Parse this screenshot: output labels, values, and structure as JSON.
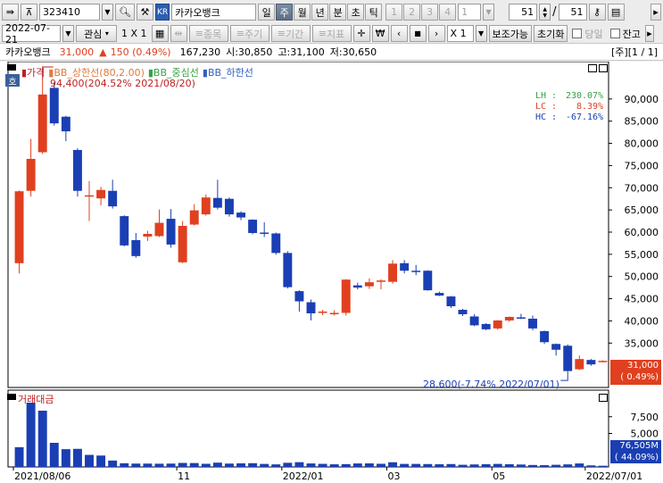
{
  "toolbar": {
    "code": "323410",
    "stock_name": "카카오뱅크",
    "periods": [
      {
        "label": "일",
        "active": false
      },
      {
        "label": "주",
        "active": true
      },
      {
        "label": "월",
        "active": false
      },
      {
        "label": "년",
        "active": false
      },
      {
        "label": "분",
        "active": false
      },
      {
        "label": "초",
        "active": false
      },
      {
        "label": "틱",
        "active": false
      }
    ],
    "ticks": [
      "1",
      "2",
      "3",
      "4"
    ],
    "tick_value": "1",
    "page_current": "51",
    "page_sep": "/",
    "page_total": "51"
  },
  "toolbar2": {
    "date": "2022-07-21",
    "interest": "관심",
    "layout": "1 X 1",
    "item": "종목",
    "cycle": "주기",
    "period": "기간",
    "indicator": "지표",
    "multiplier": "X 1",
    "aux": "보조가능",
    "reset": "초기화",
    "option1": "당일",
    "option2": "잔고"
  },
  "info": {
    "name": "카카오뱅크",
    "price": "31,000",
    "change_arrow": "▲",
    "change": "150 (0.49%)",
    "volume": "167,230",
    "open": "시:30,850",
    "high": "고:31,100",
    "low": "저:30,650",
    "pager": "[주][1 / 1]"
  },
  "colors": {
    "up": "#e0401f",
    "down": "#1a3fb4",
    "upper_band": "#e07a3c",
    "mid_band": "#38a046",
    "lower_band": "#3060c0"
  },
  "price_panel": {
    "tab": "호",
    "legend": [
      {
        "text": "가격",
        "color": "#c02020"
      },
      {
        "text": "BB_상한선(80,2.00)",
        "color": "#e07a3c"
      },
      {
        "text": "BB_중심선",
        "color": "#38a046"
      },
      {
        "text": "BB_하한선",
        "color": "#3060c0"
      }
    ],
    "max_annotation": "94,400(204.52% 2021/08/20)",
    "min_annotation": "28,600(-7.74% 2022/07/01)",
    "stats": [
      {
        "key": "LH :",
        "value": "230.07%",
        "color": "#38a046"
      },
      {
        "key": "LC :",
        "value": "8.39%",
        "color": "#e0401f"
      },
      {
        "key": "HC :",
        "value": "-67.16%",
        "color": "#1a3fb4"
      }
    ],
    "current_label": "31,000",
    "current_pct": "( 0.49%)"
  },
  "volume_panel": {
    "legend": "거래대금",
    "current_label": "76,505M",
    "current_pct": "( 44.09%)"
  },
  "chart_data": [
    {
      "type": "candlestick",
      "title": "",
      "ylim": [
        25000,
        96000
      ],
      "yticks": [
        35000,
        40000,
        45000,
        50000,
        55000,
        60000,
        65000,
        70000,
        75000,
        80000,
        85000,
        90000
      ],
      "ytick_labels": [
        "35,000",
        "40,000",
        "45,000",
        "50,000",
        "55,000",
        "60,000",
        "65,000",
        "70,000",
        "75,000",
        "80,000",
        "85,000",
        "90,000"
      ],
      "x_labels": [
        {
          "index": 0,
          "text": "2021/08/06"
        },
        {
          "index": 14,
          "text": "11"
        },
        {
          "index": 23,
          "text": "2022/01"
        },
        {
          "index": 32,
          "text": "03"
        },
        {
          "index": 41,
          "text": "05"
        },
        {
          "index": 49,
          "text": "2022/07/01"
        }
      ],
      "candles": [
        {
          "o": 53000,
          "h": 69400,
          "l": 50700,
          "c": 69200
        },
        {
          "o": 69300,
          "h": 81000,
          "l": 68000,
          "c": 76500
        },
        {
          "o": 78000,
          "h": 94400,
          "l": 77600,
          "c": 91000
        },
        {
          "o": 92500,
          "h": 93800,
          "l": 84000,
          "c": 84500
        },
        {
          "o": 86000,
          "h": 86200,
          "l": 80500,
          "c": 82700
        },
        {
          "o": 78500,
          "h": 78900,
          "l": 68000,
          "c": 69300
        },
        {
          "o": 68200,
          "h": 71500,
          "l": 62500,
          "c": 68300
        },
        {
          "o": 67600,
          "h": 70200,
          "l": 66000,
          "c": 69500
        },
        {
          "o": 69300,
          "h": 71800,
          "l": 65300,
          "c": 65800
        },
        {
          "o": 63600,
          "h": 63800,
          "l": 56800,
          "c": 57000
        },
        {
          "o": 58200,
          "h": 59800,
          "l": 54200,
          "c": 54600
        },
        {
          "o": 59000,
          "h": 60300,
          "l": 58000,
          "c": 59600
        },
        {
          "o": 59100,
          "h": 65100,
          "l": 58900,
          "c": 62100
        },
        {
          "o": 63000,
          "h": 65200,
          "l": 56500,
          "c": 57200
        },
        {
          "o": 53200,
          "h": 62500,
          "l": 53000,
          "c": 61400
        },
        {
          "o": 61700,
          "h": 66300,
          "l": 61500,
          "c": 64900
        },
        {
          "o": 64000,
          "h": 68500,
          "l": 63700,
          "c": 67800
        },
        {
          "o": 67700,
          "h": 71800,
          "l": 65100,
          "c": 65500
        },
        {
          "o": 67500,
          "h": 67800,
          "l": 63500,
          "c": 64000
        },
        {
          "o": 64400,
          "h": 64700,
          "l": 62700,
          "c": 63300
        },
        {
          "o": 62800,
          "h": 62900,
          "l": 59500,
          "c": 59800
        },
        {
          "o": 59900,
          "h": 62200,
          "l": 58900,
          "c": 59600
        },
        {
          "o": 59700,
          "h": 59900,
          "l": 54900,
          "c": 55300
        },
        {
          "o": 55300,
          "h": 55700,
          "l": 47300,
          "c": 47600
        },
        {
          "o": 46700,
          "h": 46900,
          "l": 42100,
          "c": 44400
        },
        {
          "o": 44200,
          "h": 44800,
          "l": 40100,
          "c": 41700
        },
        {
          "o": 41900,
          "h": 42500,
          "l": 41300,
          "c": 42100
        },
        {
          "o": 41500,
          "h": 42400,
          "l": 41200,
          "c": 41800
        },
        {
          "o": 41800,
          "h": 49400,
          "l": 41200,
          "c": 49300
        },
        {
          "o": 48000,
          "h": 48600,
          "l": 47100,
          "c": 47500
        },
        {
          "o": 47800,
          "h": 49600,
          "l": 47200,
          "c": 48700
        },
        {
          "o": 49000,
          "h": 49400,
          "l": 47100,
          "c": 49100
        },
        {
          "o": 48800,
          "h": 53700,
          "l": 48400,
          "c": 52900
        },
        {
          "o": 53000,
          "h": 53700,
          "l": 50700,
          "c": 51300
        },
        {
          "o": 51300,
          "h": 52600,
          "l": 50300,
          "c": 51100
        },
        {
          "o": 51300,
          "h": 51400,
          "l": 46800,
          "c": 46900
        },
        {
          "o": 46300,
          "h": 46600,
          "l": 45600,
          "c": 45700
        },
        {
          "o": 45500,
          "h": 45600,
          "l": 42900,
          "c": 43300
        },
        {
          "o": 42500,
          "h": 42700,
          "l": 41100,
          "c": 41500
        },
        {
          "o": 41000,
          "h": 41500,
          "l": 38800,
          "c": 39000
        },
        {
          "o": 39300,
          "h": 39500,
          "l": 37900,
          "c": 38100
        },
        {
          "o": 38300,
          "h": 40200,
          "l": 38000,
          "c": 40100
        },
        {
          "o": 40100,
          "h": 41000,
          "l": 39800,
          "c": 40900
        },
        {
          "o": 40800,
          "h": 41600,
          "l": 40400,
          "c": 40500
        },
        {
          "o": 40500,
          "h": 41200,
          "l": 37900,
          "c": 38300
        },
        {
          "o": 37700,
          "h": 37800,
          "l": 34800,
          "c": 35200
        },
        {
          "o": 34800,
          "h": 34900,
          "l": 32200,
          "c": 33500
        },
        {
          "o": 34400,
          "h": 34700,
          "l": 28600,
          "c": 28700
        },
        {
          "o": 29100,
          "h": 32200,
          "l": 28900,
          "c": 31400
        },
        {
          "o": 31200,
          "h": 31400,
          "l": 29900,
          "c": 30200
        },
        {
          "o": 30850,
          "h": 31100,
          "l": 30650,
          "c": 31000
        }
      ],
      "bb_upper": [
        null
      ],
      "bb_mid": [
        null
      ],
      "bb_lower": [
        null
      ]
    },
    {
      "type": "bar",
      "title": "",
      "ylim": [
        0,
        10000
      ],
      "yticks": [
        5000,
        7500
      ],
      "ytick_labels": [
        "5,000",
        "7,500"
      ],
      "values": [
        2950,
        9600,
        8400,
        3600,
        2650,
        2700,
        1800,
        1700,
        950,
        550,
        500,
        500,
        480,
        500,
        600,
        580,
        470,
        640,
        500,
        540,
        560,
        450,
        380,
        620,
        710,
        520,
        460,
        390,
        420,
        520,
        530,
        470,
        700,
        450,
        450,
        430,
        400,
        430,
        320,
        370,
        400,
        450,
        400,
        360,
        290,
        260,
        320,
        380,
        520,
        230,
        180
      ]
    }
  ]
}
